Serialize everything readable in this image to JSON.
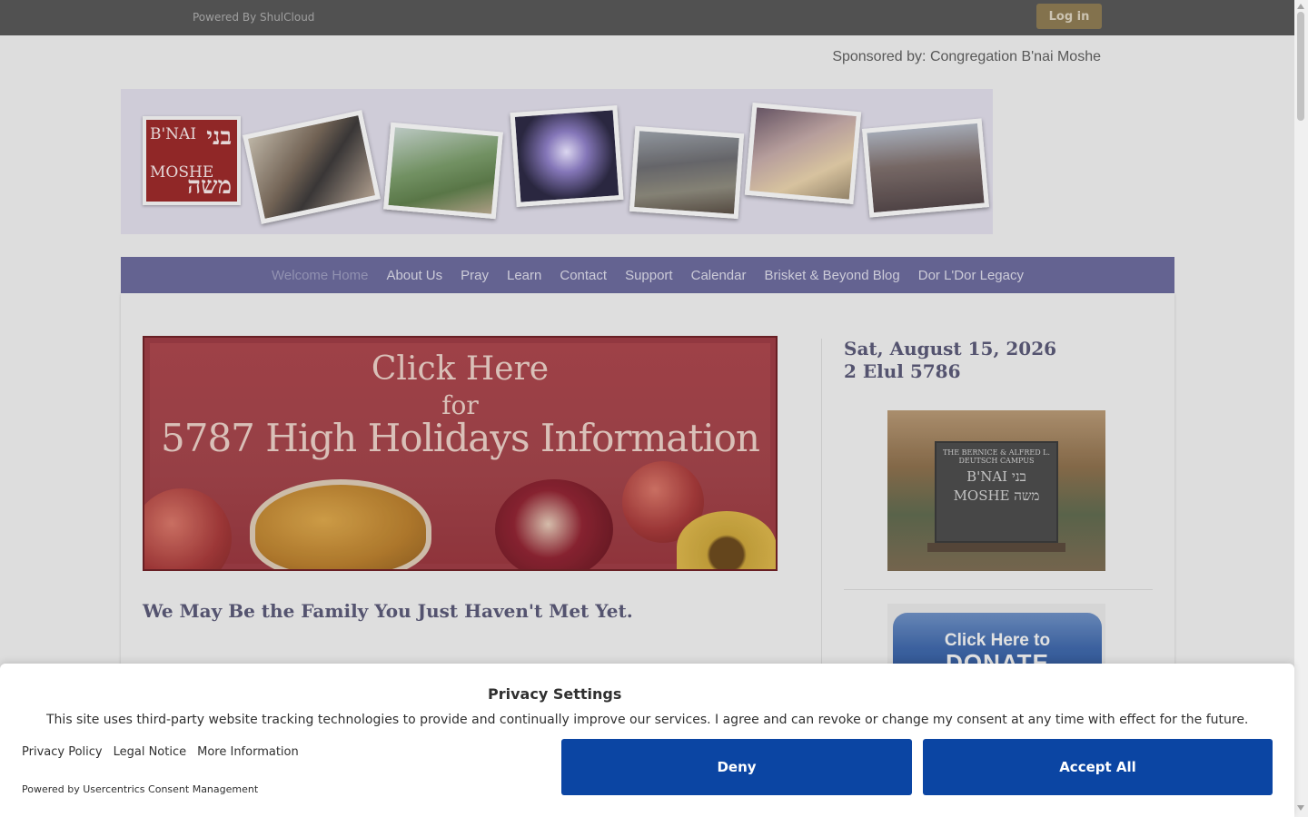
{
  "topbar": {
    "powered_by": "Powered By ShulCloud",
    "login_label": "Log in"
  },
  "sponsored": "Sponsored by: Congregation B'nai Moshe",
  "logo": {
    "line1": "B'NAI",
    "line2": "בני",
    "line3": "MOSHE",
    "line4": "משה"
  },
  "nav": {
    "items": [
      {
        "label": "Welcome Home",
        "active": true
      },
      {
        "label": "About Us"
      },
      {
        "label": "Pray"
      },
      {
        "label": "Learn"
      },
      {
        "label": "Contact"
      },
      {
        "label": "Support"
      },
      {
        "label": "Calendar"
      },
      {
        "label": "Brisket & Beyond Blog"
      },
      {
        "label": "Dor L'Dor Legacy"
      }
    ]
  },
  "high_holidays": {
    "line1": "Click Here",
    "line2": "for",
    "line3": "5787 High Holidays Information"
  },
  "main": {
    "heading": "We May Be the Family You Just Haven't Met Yet."
  },
  "sidebar": {
    "date_english": "Sat, August 15, 2026",
    "date_hebrew": "2 Elul 5786",
    "campus_sign": {
      "line1": "THE BERNICE & ALFRED L. DEUTSCH CAMPUS",
      "line2": "B'NAI בני",
      "line3": "MOSHE משה"
    },
    "donate": {
      "line1": "Click Here to",
      "line2": "DONATE"
    }
  },
  "privacy": {
    "title": "Privacy Settings",
    "text": "This site uses third-party website tracking technologies to provide and continually improve our services. I agree and can revoke or change my consent at any time with effect for the future.",
    "links": [
      "Privacy Policy",
      "Legal Notice",
      "More Information"
    ],
    "powered": "Powered by Usercentrics Consent Management",
    "deny_label": "Deny",
    "accept_label": "Accept All"
  },
  "colors": {
    "nav_bg": "#6b6a9b",
    "topbar_bg": "#575757",
    "consent_button": "#0b45a3",
    "heading": "#5a5976"
  }
}
